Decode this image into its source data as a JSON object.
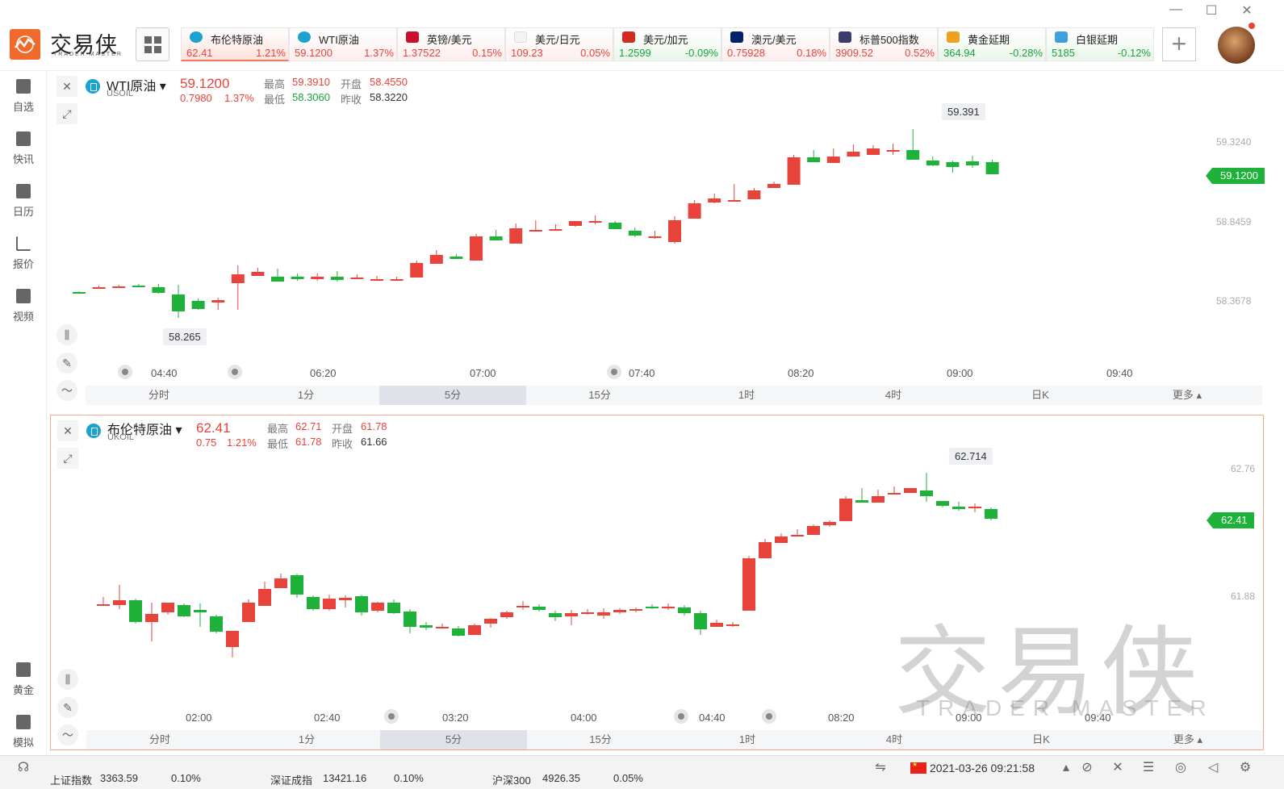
{
  "app": {
    "brand": "交易侠",
    "brand_sub": "TRADER MASTER"
  },
  "tickers": [
    {
      "name": "布伦特原油",
      "price": "62.41",
      "pct": "1.21%",
      "dir": "up",
      "icon": "oil-icon",
      "selected": true
    },
    {
      "name": "WTI原油",
      "price": "59.1200",
      "pct": "1.37%",
      "dir": "up",
      "icon": "oil-icon",
      "selected": false
    },
    {
      "name": "英镑/美元",
      "price": "1.37522",
      "pct": "0.15%",
      "dir": "up",
      "icon": "uk-flag-icon",
      "selected": false
    },
    {
      "name": "美元/日元",
      "price": "109.23",
      "pct": "0.05%",
      "dir": "up",
      "icon": "jp-flag-icon",
      "selected": false
    },
    {
      "name": "美元/加元",
      "price": "1.2599",
      "pct": "-0.09%",
      "dir": "down",
      "icon": "ca-flag-icon",
      "selected": false
    },
    {
      "name": "澳元/美元",
      "price": "0.75928",
      "pct": "0.18%",
      "dir": "up",
      "icon": "au-flag-icon",
      "selected": false
    },
    {
      "name": "标普500指数",
      "price": "3909.52",
      "pct": "0.52%",
      "dir": "up",
      "icon": "us-flag-icon",
      "selected": false
    },
    {
      "name": "黄金延期",
      "price": "364.94",
      "pct": "-0.28%",
      "dir": "down",
      "icon": "gold-icon",
      "selected": false
    },
    {
      "name": "白银延期",
      "price": "5185",
      "pct": "-0.12%",
      "dir": "down",
      "icon": "silver-icon",
      "selected": false
    }
  ],
  "sidebar": {
    "items": [
      {
        "label": "自选",
        "icon": "bookmark-plus-icon"
      },
      {
        "label": "快讯",
        "icon": "news-icon"
      },
      {
        "label": "日历",
        "icon": "calendar-icon"
      },
      {
        "label": "报价",
        "icon": "chart-line-icon"
      },
      {
        "label": "视频",
        "icon": "video-icon"
      },
      {
        "label": "黄金",
        "icon": "gold-bars-icon"
      },
      {
        "label": "模拟",
        "icon": "wallet-icon"
      }
    ]
  },
  "panels": [
    {
      "name": "WTI原油",
      "code": "USOIL",
      "price": "59.1200",
      "change": "0.7980",
      "change_pct": "1.37%",
      "high_label": "最高",
      "high": "59.3910",
      "open_label": "开盘",
      "open": "58.4550",
      "low_label": "最低",
      "low": "58.3060",
      "prev_label": "昨收",
      "prev": "58.3220",
      "last_tag": "59.1200",
      "y_labels": [
        "59.3240",
        "58.8459",
        "58.3678"
      ],
      "x_labels": [
        "04:40",
        "06:20",
        "07:00",
        "07:40",
        "08:20",
        "09:00",
        "09:40"
      ],
      "high_annotation": "59.391",
      "low_annotation": "58.265"
    },
    {
      "name": "布伦特原油",
      "code": "UKOIL",
      "price": "62.41",
      "change": "0.75",
      "change_pct": "1.21%",
      "high_label": "最高",
      "high": "62.71",
      "open_label": "开盘",
      "open": "61.78",
      "low_label": "最低",
      "low": "61.78",
      "prev_label": "昨收",
      "prev": "61.66",
      "last_tag": "62.41",
      "y_labels": [
        "62.76",
        "61.88"
      ],
      "x_labels": [
        "02:00",
        "02:40",
        "03:20",
        "04:00",
        "04:40",
        "08:20",
        "09:00",
        "09:40"
      ],
      "high_annotation": "62.714"
    }
  ],
  "timeframes": [
    "分时",
    "1分",
    "5分",
    "15分",
    "1时",
    "4时",
    "日K",
    "更多"
  ],
  "active_timeframe": "5分",
  "watermark": {
    "text": "交易侠",
    "sub": "TRADER MASTER"
  },
  "statusbar": {
    "datetime": "2021-03-26 09:21:58",
    "index1_name": "上证指数",
    "index1_value": "3363.59",
    "index1_pct": "0.10%",
    "index2_name": "深证成指",
    "index2_value": "13421.16",
    "index2_pct": "0.10%",
    "index3_name": "沪深300",
    "index3_value": "4926.35",
    "index3_pct": "0.05%"
  },
  "colors": {
    "up": "#e8433a",
    "down": "#1aa33a",
    "accent": "#f06a2b"
  }
}
